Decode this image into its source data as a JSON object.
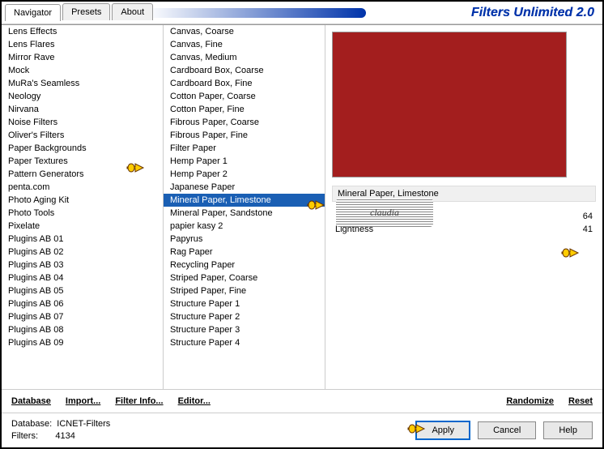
{
  "header": {
    "title": "Filters Unlimited 2.0"
  },
  "tabs": [
    {
      "label": "Navigator",
      "active": true
    },
    {
      "label": "Presets",
      "active": false
    },
    {
      "label": "About",
      "active": false
    }
  ],
  "left_list": [
    "Lens Effects",
    "Lens Flares",
    "Mirror Rave",
    "Mock",
    "MuRa's Seamless",
    "Neology",
    "Nirvana",
    "Noise Filters",
    "Oliver's Filters",
    "Paper Backgrounds",
    "Paper Textures",
    "Pattern Generators",
    "penta.com",
    "Photo Aging Kit",
    "Photo Tools",
    "Pixelate",
    "Plugins AB 01",
    "Plugins AB 02",
    "Plugins AB 03",
    "Plugins AB 04",
    "Plugins AB 05",
    "Plugins AB 06",
    "Plugins AB 07",
    "Plugins AB 08",
    "Plugins AB 09"
  ],
  "left_selected_index": 10,
  "mid_list": [
    "Canvas, Coarse",
    "Canvas, Fine",
    "Canvas, Medium",
    "Cardboard Box, Coarse",
    "Cardboard Box, Fine",
    "Cotton Paper, Coarse",
    "Cotton Paper, Fine",
    "Fibrous Paper, Coarse",
    "Fibrous Paper, Fine",
    "Filter Paper",
    "Hemp Paper 1",
    "Hemp Paper 2",
    "Japanese Paper",
    "Mineral Paper, Limestone",
    "Mineral Paper, Sandstone",
    "papier kasy 2",
    "Papyrus",
    "Rag Paper",
    "Recycling Paper",
    "Striped Paper, Coarse",
    "Striped Paper, Fine",
    "Structure Paper 1",
    "Structure Paper 2",
    "Structure Paper 3",
    "Structure Paper 4"
  ],
  "mid_selected_index": 13,
  "preview_color": "#a31e1e",
  "filter_name": "Mineral Paper, Limestone",
  "params": [
    {
      "label": "Intensity",
      "value": 64
    },
    {
      "label": "Lightness",
      "value": 41
    }
  ],
  "bottom_links": {
    "database": "Database",
    "import": "Import...",
    "filter_info": "Filter Info...",
    "editor": "Editor...",
    "randomize": "Randomize",
    "reset": "Reset"
  },
  "status": {
    "database_label": "Database:",
    "database_value": "ICNET-Filters",
    "filters_label": "Filters:",
    "filters_value": "4134"
  },
  "buttons": {
    "apply": "Apply",
    "cancel": "Cancel",
    "help": "Help"
  },
  "watermark_text": "claudia"
}
